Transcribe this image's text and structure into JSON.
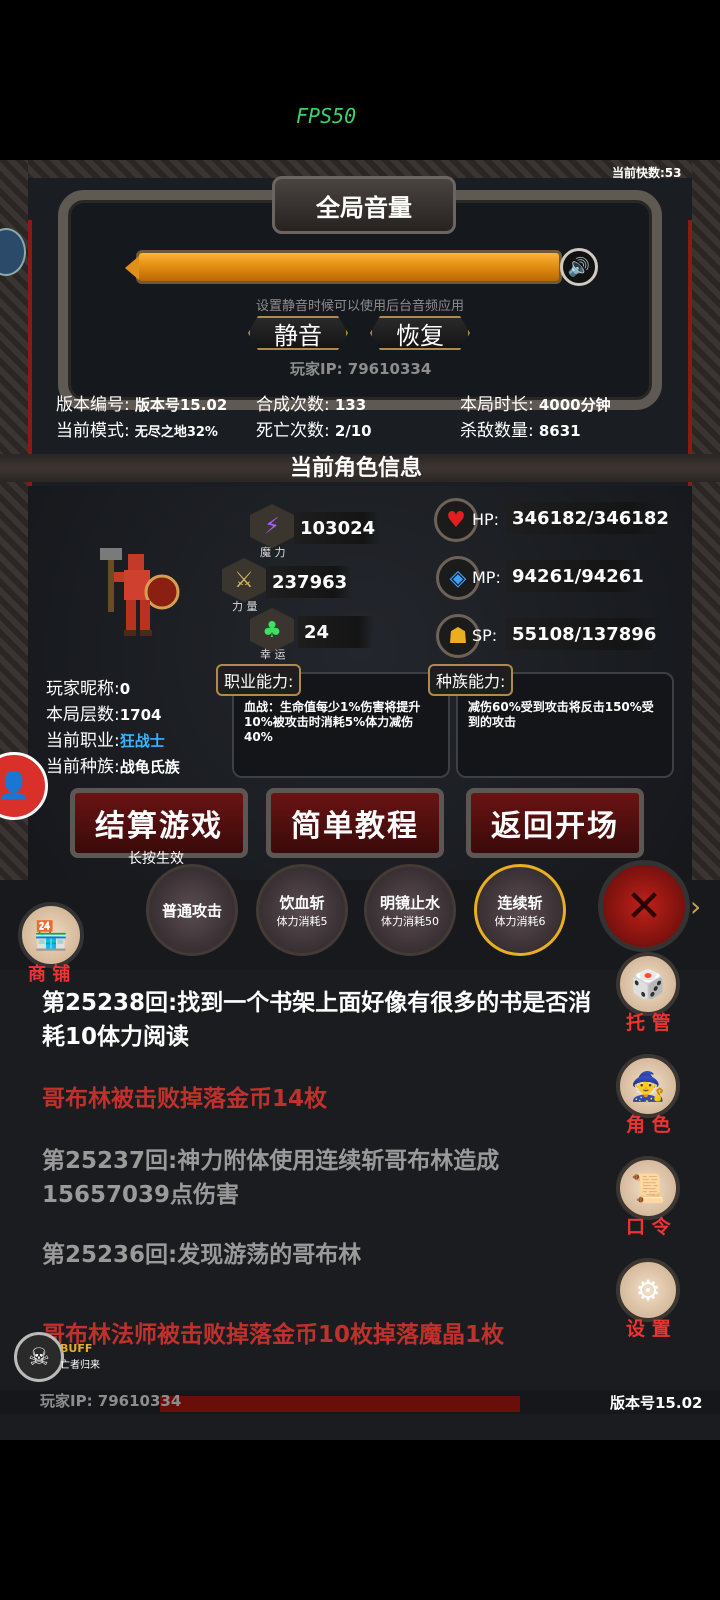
{
  "fps": "FPS50",
  "live_count": "当前快数:53",
  "volume": {
    "title": "全局音量",
    "level_percent": 100,
    "hint": "设置静音时候可以使用后台音频应用",
    "mute_label": "静音",
    "restore_label": "恢复",
    "player_ip": "玩家IP:  79610334"
  },
  "stats": {
    "version_label": "版本编号:",
    "version_value": "版本号15.02",
    "synth_label": "合成次数:",
    "synth_value": "133",
    "duration_label": "本局时长:",
    "duration_value": "4000分钟",
    "mode_label": "当前模式:",
    "mode_value": "无尽之地32%",
    "death_label": "死亡次数:",
    "death_value": "2/10",
    "kills_label": "杀敌数量:",
    "kills_value": "8631"
  },
  "role": {
    "title": "当前角色信息",
    "magic_value": "103024",
    "magic_label": "魔 力",
    "power_value": "237963",
    "power_label": "力 量",
    "luck_value": "24",
    "luck_label": "幸 运",
    "hp": "HP:",
    "hp_value": "346182/346182",
    "mp": "MP:",
    "mp_value": "94261/94261",
    "sp": "SP:",
    "sp_value": "55108/137896",
    "nickname_label": "玩家昵称:",
    "nickname_value": "0",
    "floors_label": "本局层数:",
    "floors_value": "1704",
    "job_label": "当前职业:",
    "job_value": "狂战士",
    "race_label": "当前种族:",
    "race_value": "战龟氏族",
    "job_ability_tag": "职业能力:",
    "job_ability_text": "血战：生命值每少1%伤害将提升10%被攻击时消耗5%体力减伤40%",
    "race_ability_tag": "种族能力:",
    "race_ability_text": "减伤60%受到攻击将反击150%受到的攻击"
  },
  "buttons": {
    "settle": "结算游戏",
    "settle_hint": "长按生效",
    "tutorial": "简单教程",
    "back": "返回开场"
  },
  "skills": [
    {
      "name": "普通攻击",
      "cost": ""
    },
    {
      "name": "饮血斩",
      "cost": "体力消耗5"
    },
    {
      "name": "明镜止水",
      "cost": "体力消耗50"
    },
    {
      "name": "连续斩",
      "cost": "体力消耗6"
    }
  ],
  "shop_label": "商 铺",
  "side": {
    "auto": "托 管",
    "role": "角 色",
    "code": "口 令",
    "settings": "设 置"
  },
  "log": [
    {
      "text": "第25238回:找到一个书架上面好像有很多的书是否消耗10体力阅读",
      "color": "#ffffff"
    },
    {
      "text": "哥布林被击败掉落金币14枚",
      "color": "#c0312b"
    },
    {
      "text": "第25237回:神力附体使用连续斩哥布林造成15657039点伤害",
      "color": "#9a9a9a"
    },
    {
      "text": "第25236回:发现游荡的哥布林",
      "color": "#9a9a9a"
    },
    {
      "text": "哥布林法师被击败掉落金币10枚掉落魔晶1枚",
      "color": "#c0312b"
    }
  ],
  "buff": {
    "title": "BUFF",
    "sub": "亡者归来"
  },
  "footer": {
    "ip": "玩家IP:  79610334",
    "version": "版本号15.02"
  },
  "colors": {
    "accent": "#e8901a",
    "job": "#3ab4ff",
    "danger": "#c0312b"
  }
}
